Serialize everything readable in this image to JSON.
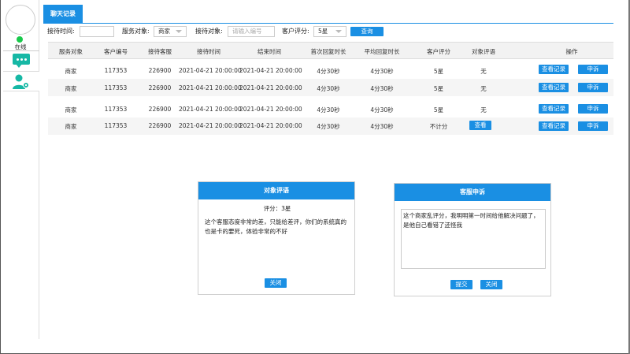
{
  "sidebar": {
    "status_label": "在线"
  },
  "tab": {
    "label": "聊天记录"
  },
  "filters": {
    "time_label": "接待时间:",
    "time_value": "",
    "target_label": "服务对象:",
    "target_value": "商家",
    "reception_label": "接待对象:",
    "reception_placeholder": "请输入编号",
    "rating_label": "客户评分:",
    "rating_value": "5星",
    "query_button": "查询"
  },
  "table": {
    "headers": [
      "服务对象",
      "客户编号",
      "接待客服",
      "接待时间",
      "结束时间",
      "首次回复时长",
      "平均回复时长",
      "客户评分",
      "对象评语",
      "操作"
    ],
    "rows": [
      {
        "target": "商家",
        "customer_id": "117353",
        "agent": "226900",
        "start": "2021-04-21 20:00:00",
        "end": "2021-04-21 20:00:00",
        "first_reply": "4分30秒",
        "avg_reply": "4分30秒",
        "rating": "5星",
        "comment": "无",
        "comment_button": "",
        "history": "查看记录",
        "appeal": "申诉"
      },
      {
        "target": "商家",
        "customer_id": "117353",
        "agent": "226900",
        "start": "2021-04-21 20:00:00",
        "end": "2021-04-21 20:00:00",
        "first_reply": "4分30秒",
        "avg_reply": "4分30秒",
        "rating": "5星",
        "comment": "无",
        "comment_button": "",
        "history": "查看记录",
        "appeal": "申诉"
      },
      {
        "target": "商家",
        "customer_id": "117353",
        "agent": "226900",
        "start": "2021-04-21 20:00:00",
        "end": "2021-04-21 20:00:00",
        "first_reply": "4分30秒",
        "avg_reply": "4分30秒",
        "rating": "5星",
        "comment": "无",
        "comment_button": "",
        "history": "查看记录",
        "appeal": "申诉"
      },
      {
        "target": "商家",
        "customer_id": "117353",
        "agent": "226900",
        "start": "2021-04-21 20:00:00",
        "end": "2021-04-21 20:00:00",
        "first_reply": "4分30秒",
        "avg_reply": "4分30秒",
        "rating": "不计分",
        "comment": "",
        "comment_button": "查看",
        "history": "查看记录",
        "appeal": "申诉"
      }
    ]
  },
  "review_panel": {
    "title": "对象评语",
    "score": "评分：3星",
    "text": "这个客服态度非常的差，只能给差评，你们的系统真的也是卡的要死，体验非常的不好",
    "close_button": "关闭"
  },
  "appeal_panel": {
    "title": "客服申诉",
    "text": "这个商家乱评分，我明明第一时间给他解决问题了，是他自己看错了还怪我",
    "submit_button": "提交",
    "close_button": "关闭"
  },
  "colors": {
    "accent": "#1a8fe3",
    "online": "#19c94b",
    "chat_icon": "#16b8a5"
  }
}
